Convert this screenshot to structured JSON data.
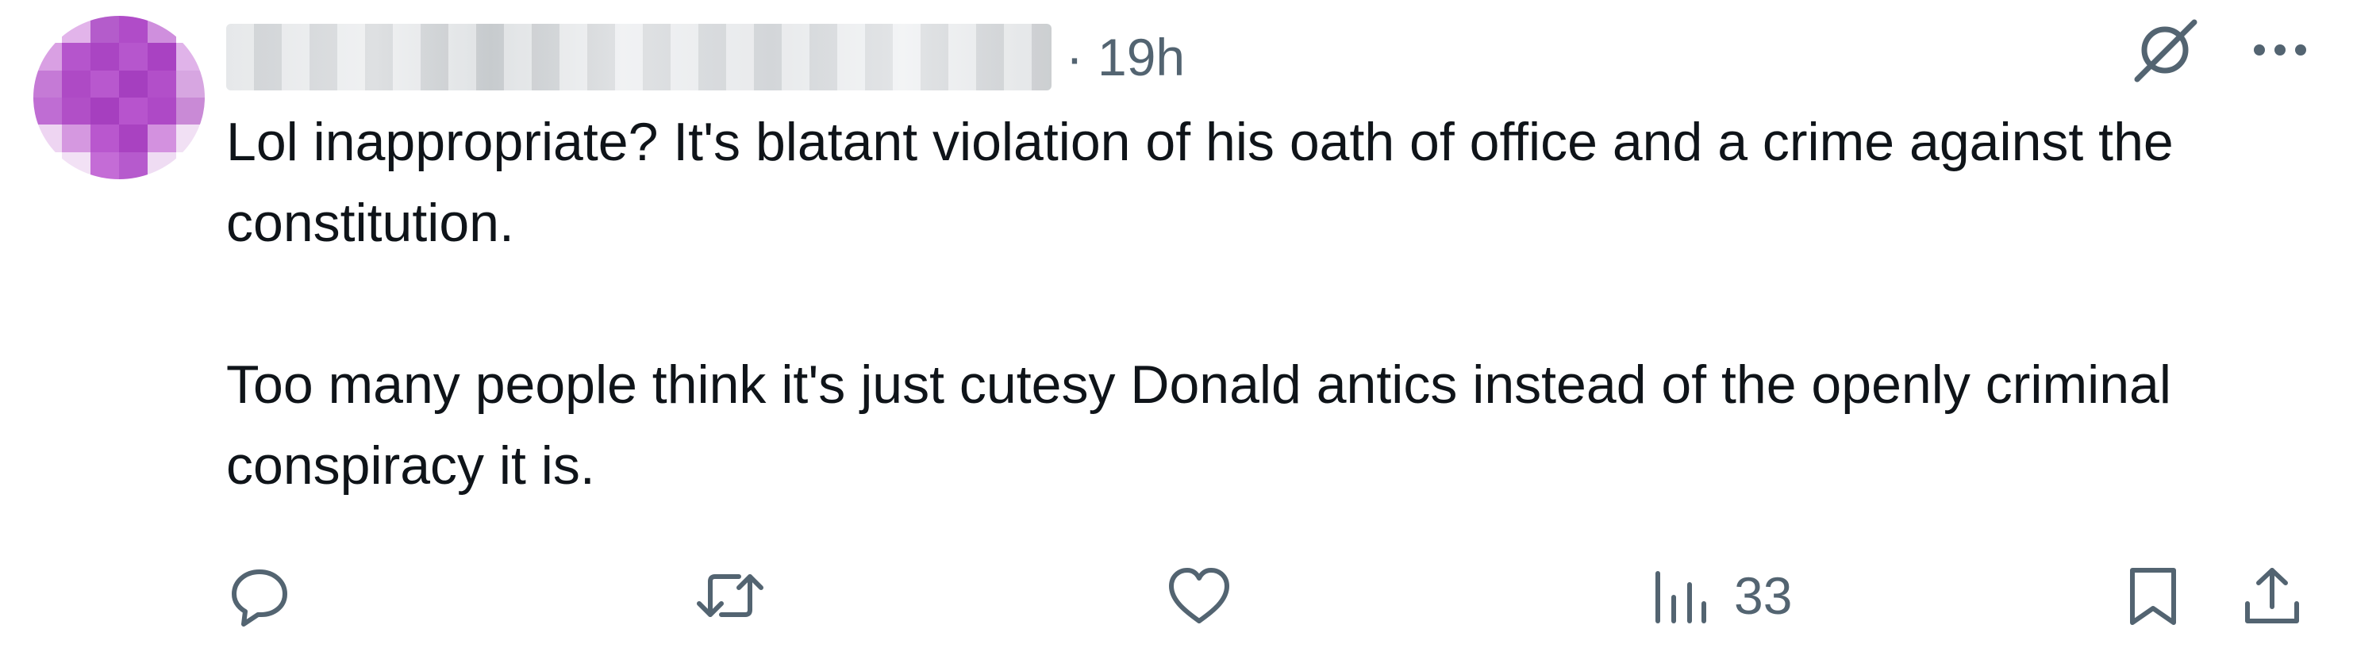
{
  "tweet": {
    "time": "19h",
    "separator": "·",
    "text_paragraphs": [
      "Lol inappropriate? It's blatant violation of his oath of office and a crime against the constitution.",
      "Too many people think it's just cutesy Donald antics instead of the openly criminal conspiracy it is."
    ]
  },
  "actions": {
    "reply_count": "",
    "retweet_count": "",
    "like_count": "",
    "views_count": "33"
  },
  "icons": {
    "grok": "grok-icon",
    "more": "more-icon",
    "reply": "reply-icon",
    "retweet": "retweet-icon",
    "like": "heart-icon",
    "views": "views-icon",
    "bookmark": "bookmark-icon",
    "share": "share-icon"
  },
  "colors": {
    "text_primary": "#0f1419",
    "text_secondary": "#536471",
    "avatar_purple": "#b04cc8"
  }
}
